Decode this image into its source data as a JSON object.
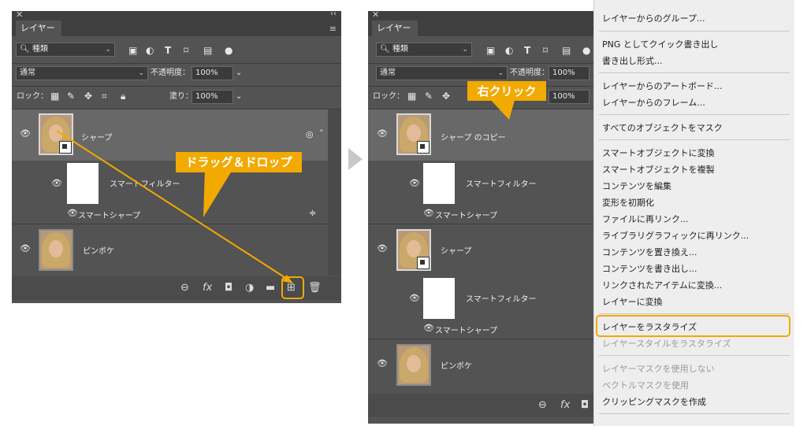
{
  "panel_left": {
    "tab": "レイヤー",
    "filter_kind": "種類",
    "blend_mode": "通常",
    "opacity_label": "不透明度：",
    "opacity_value": "100%",
    "lock_label": "ロック：",
    "fill_label": "塗り：",
    "fill_value": "100%",
    "layers": [
      {
        "name": "シャープ"
      },
      {
        "name": "スマートフィルター"
      },
      {
        "name": "スマートシャープ"
      },
      {
        "name": "ピンボケ"
      }
    ]
  },
  "panel_right": {
    "tab": "レイヤー",
    "filter_kind": "種類",
    "blend_mode": "通常",
    "opacity_label": "不透明度：",
    "opacity_value": "100%",
    "lock_label": "ロック：",
    "fill_value": "100%",
    "layers": [
      {
        "name": "シャープ のコピー"
      },
      {
        "name": "スマートフィルター"
      },
      {
        "name": "スマートシャープ"
      },
      {
        "name": "シャープ"
      },
      {
        "name": "スマートフィルター"
      },
      {
        "name": "スマートシャープ"
      },
      {
        "name": "ピンボケ"
      }
    ]
  },
  "callouts": {
    "drag_drop": "ドラッグ＆ドロップ",
    "right_click": "右クリック"
  },
  "context_menu": {
    "items": [
      {
        "label": "レイヤーからのグループ...",
        "disabled": false
      },
      {
        "label": "PNG としてクイック書き出し",
        "disabled": false
      },
      {
        "label": "書き出し形式...",
        "disabled": false
      },
      {
        "label": "レイヤーからのアートボード...",
        "disabled": false
      },
      {
        "label": "レイヤーからのフレーム...",
        "disabled": false
      },
      {
        "label": "すべてのオブジェクトをマスク",
        "disabled": false
      },
      {
        "label": "スマートオブジェクトに変換",
        "disabled": false
      },
      {
        "label": "スマートオブジェクトを複製",
        "disabled": false
      },
      {
        "label": "コンテンツを編集",
        "disabled": false
      },
      {
        "label": "変形を初期化",
        "disabled": false
      },
      {
        "label": "ファイルに再リンク...",
        "disabled": false
      },
      {
        "label": "ライブラリグラフィックに再リンク...",
        "disabled": false
      },
      {
        "label": "コンテンツを置き換え...",
        "disabled": false
      },
      {
        "label": "コンテンツを書き出し...",
        "disabled": false
      },
      {
        "label": "リンクされたアイテムに変換...",
        "disabled": false
      },
      {
        "label": "レイヤーに変換",
        "disabled": false
      },
      {
        "label": "レイヤーをラスタライズ",
        "disabled": false
      },
      {
        "label": "レイヤースタイルをラスタライズ",
        "disabled": true
      },
      {
        "label": "レイヤーマスクを使用しない",
        "disabled": true
      },
      {
        "label": "ベクトルマスクを使用",
        "disabled": true
      },
      {
        "label": "クリッピングマスクを作成",
        "disabled": false
      }
    ]
  },
  "colors": {
    "accent": "#f2a900",
    "panel_bg": "#535353"
  }
}
